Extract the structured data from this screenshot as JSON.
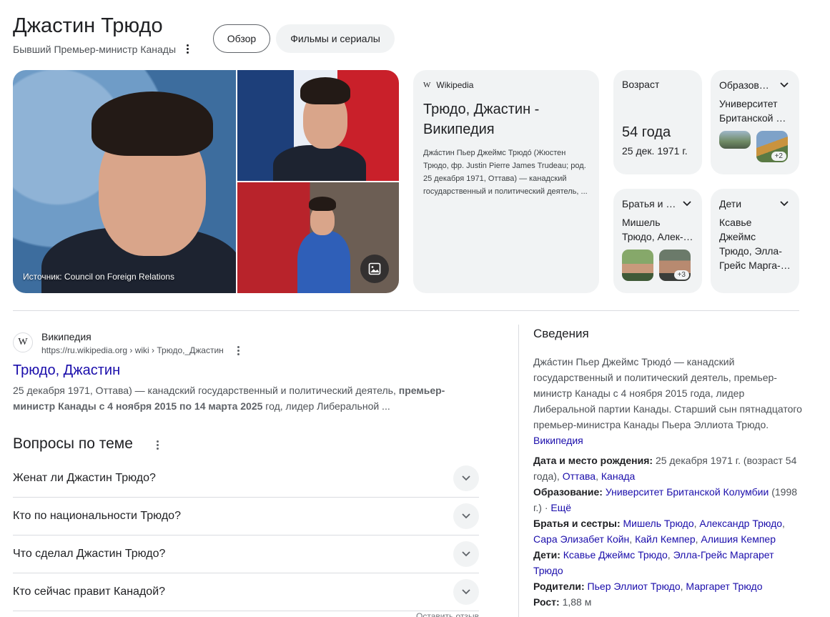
{
  "header": {
    "title": "Джастин Трюдо",
    "subtitle": "Бывший Премьер-министр Канады",
    "tabs": [
      {
        "label": "Обзор",
        "active": true
      },
      {
        "label": "Фильмы и сериалы",
        "active": false
      }
    ]
  },
  "images": {
    "source_label": "Источник: Council on Foreign Relations"
  },
  "wiki_card": {
    "source": "Wikipedia",
    "title": "Трюдо, Джастин - Википедия",
    "snippet": "Джа́стин Пьер Джеймс Трюдо́ (Жюстен Трюдо, фр. Justin Pierre James Trudeau; род. 25 декабря 1971, Оттава) — канадский государственный и политический деятель, ..."
  },
  "facts": {
    "age": {
      "label": "Возраст",
      "value": "54 года",
      "date": "25 дек. 1971 г."
    },
    "education": {
      "label": "Образов…",
      "value": "Университет Британской …",
      "more": "+2"
    },
    "siblings": {
      "label": "Братья и …",
      "value": "Мишель Трюдо, Алек-…",
      "more": "+3"
    },
    "children": {
      "label": "Дети",
      "value": "Ксавье Джеймс Трюдо, Элла-Грейс Марга-…"
    }
  },
  "result": {
    "site_name": "Википедия",
    "favicon": "W",
    "url": "https://ru.wikipedia.org › wiki › Трюдо,_Джастин",
    "title": "Трюдо, Джастин",
    "snippet_1": "25 декабря 1971, Оттава) — канадский государственный и политический деятель, ",
    "snippet_bold": "премьер-министр Канады с 4 ноября 2015 по 14 марта 2025",
    "snippet_2": " год, лидер Либеральной ..."
  },
  "questions": {
    "title": "Вопросы по теме",
    "items": [
      "Женат ли Джастин Трюдо?",
      "Кто по национальности Трюдо?",
      "Что сделал Джастин Трюдо?",
      "Кто сейчас правит Канадой?"
    ],
    "feedback": "Оставить отзыв"
  },
  "info": {
    "title": "Сведения",
    "description": "Джа́стин Пьер Джеймс Трюдо́ — канадский государственный и политический деятель, премьер-министр Канады с 4 ноября 2015 года, лидер Либеральной партии Канады. Старший сын пятнадцатого премьер-министра Канады Пьера Эллиота Трюдо.",
    "description_link": "Википедия",
    "birth": {
      "label": "Дата и место рождения:",
      "text": "25 декабря 1971 г. (возраст 54 года),",
      "link_1": "Оттава",
      "sep": ",",
      "link_2": "Канада"
    },
    "education": {
      "label": "Образование:",
      "link": "Университет Британской Колумбии",
      "text": "(1998 г.) ·",
      "more": "Ещё"
    },
    "siblings": {
      "label": "Братья и сестры:",
      "links": [
        "Мишель Трюдо",
        "Александр Трюдо",
        "Сара Элизабет Койн",
        "Кайл Кемпер",
        "Алишия Кемпер"
      ]
    },
    "children": {
      "label": "Дети:",
      "links": [
        "Ксавье Джеймс Трюдо",
        "Элла-Грейс Маргарет Трюдо"
      ]
    },
    "parents": {
      "label": "Родители:",
      "links": [
        "Пьер Эллиот Трюдо",
        "Маргарет Трюдо"
      ]
    },
    "height": {
      "label": "Рост:",
      "text": "1,88 м"
    }
  },
  "icons": [
    "more-vert-icon",
    "image-icon",
    "chevron-down-icon",
    "wikipedia-icon"
  ]
}
